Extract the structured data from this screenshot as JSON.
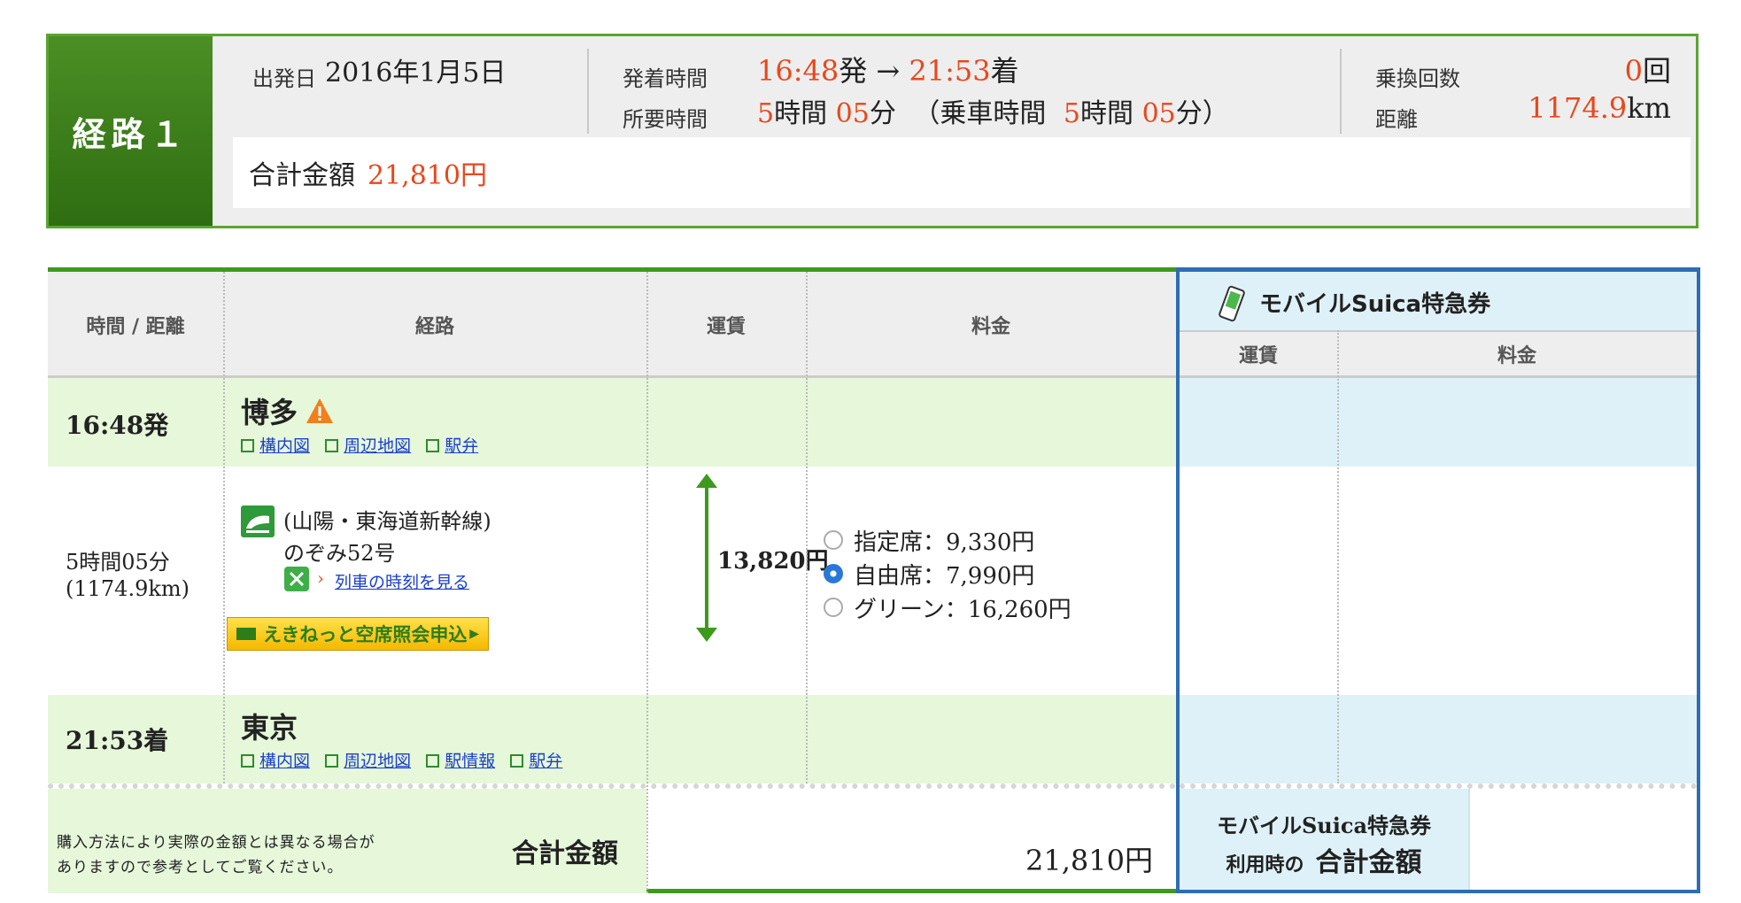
{
  "summary": {
    "route_label": "経路１",
    "departure_date_label": "出発日",
    "departure_date": "2016年1月5日",
    "dep_arr_label": "発着時間",
    "dep_time": "16:48",
    "dep_suffix": "発",
    "arrow": "→",
    "arr_time": "21:53",
    "arr_suffix": "着",
    "duration_label": "所要時間",
    "duration_h": "5",
    "duration_h_unit": "時間",
    "duration_m": "05",
    "duration_m_unit": "分",
    "ride_time_prefix": "（乗車時間",
    "ride_h": "5",
    "ride_h_unit": "時間",
    "ride_m": "05",
    "ride_m_unit": "分）",
    "transfers_label": "乗換回数",
    "transfers_value": "0",
    "transfers_unit": "回",
    "distance_label": "距離",
    "distance_value": "1174.9",
    "distance_unit": "km",
    "total_label": "合計金額",
    "total_value": "21,810円"
  },
  "table": {
    "headers": {
      "time_distance": "時間 / 距離",
      "route": "経路",
      "fare": "運賃",
      "charge": "料金"
    },
    "departure": {
      "time": "16:48発",
      "station": "博多",
      "links": [
        "構内図",
        "周辺地図",
        "駅弁"
      ]
    },
    "segment": {
      "duration": "5時間05分",
      "distance": "(1174.9km)",
      "line": "(山陽・東海道新幹線)",
      "train": "のぞみ52号",
      "timetable_link": "列車の時刻を見る",
      "ekinet_button": "えきねっと空席照会申込",
      "fare": "13,820円",
      "options": [
        {
          "label": "指定席：9,330円",
          "selected": false
        },
        {
          "label": "自由席：7,990円",
          "selected": true
        },
        {
          "label": "グリーン：16,260円",
          "selected": false
        }
      ]
    },
    "arrival": {
      "time": "21:53着",
      "station": "東京",
      "links": [
        "構内図",
        "周辺地図",
        "駅情報",
        "駅弁"
      ]
    },
    "footer": {
      "note_line1": "購入方法により実際の金額とは異なる場合が",
      "note_line2": "ありますので参考としてご覧ください。",
      "total_label": "合計金額",
      "total_value": "21,810円"
    }
  },
  "suica": {
    "title": "モバイルSuica特急券",
    "fare_header": "運賃",
    "charge_header": "料金",
    "footer_line1": "モバイルSuica特急券",
    "footer_line2_prefix": "利用時の",
    "footer_line2_bold": "合計金額"
  },
  "colors": {
    "accent_green": "#3e9a1c",
    "accent_blue": "#2d6db3",
    "price_red": "#e8481c"
  }
}
